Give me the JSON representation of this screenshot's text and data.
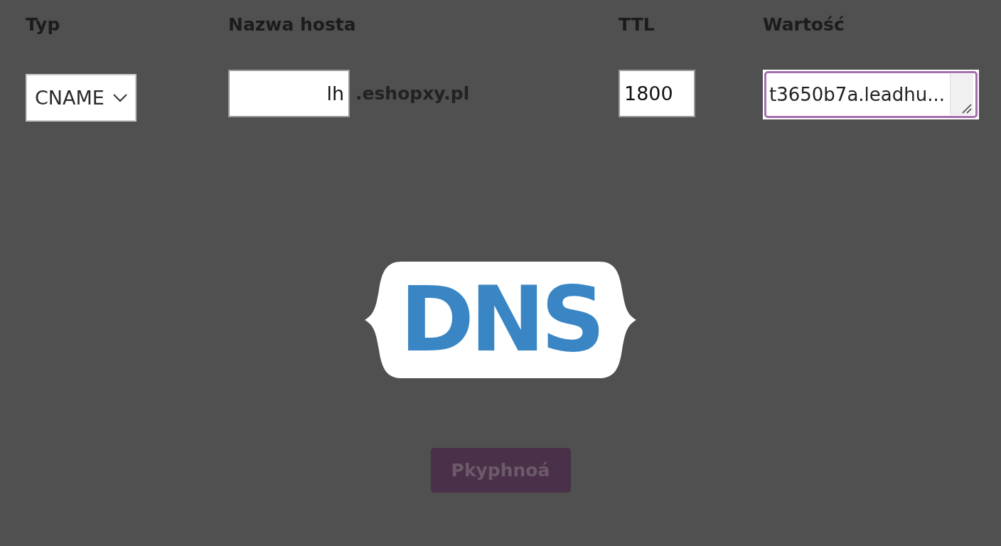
{
  "columns": [
    "Typ",
    "Nazwa hosta",
    "TTL",
    "Wartość"
  ],
  "record": {
    "type": {
      "value": "CNAME"
    },
    "host": {
      "value": "lh",
      "suffix": ".eshopxy.pl"
    },
    "ttl": {
      "value": "1800"
    },
    "value": {
      "value": "t3650b7a.leadhu...",
      "focused": true
    }
  },
  "logo": {
    "text": "DNS"
  },
  "submit_button": {
    "label": "Pkyphnoá",
    "disabled": true
  }
}
